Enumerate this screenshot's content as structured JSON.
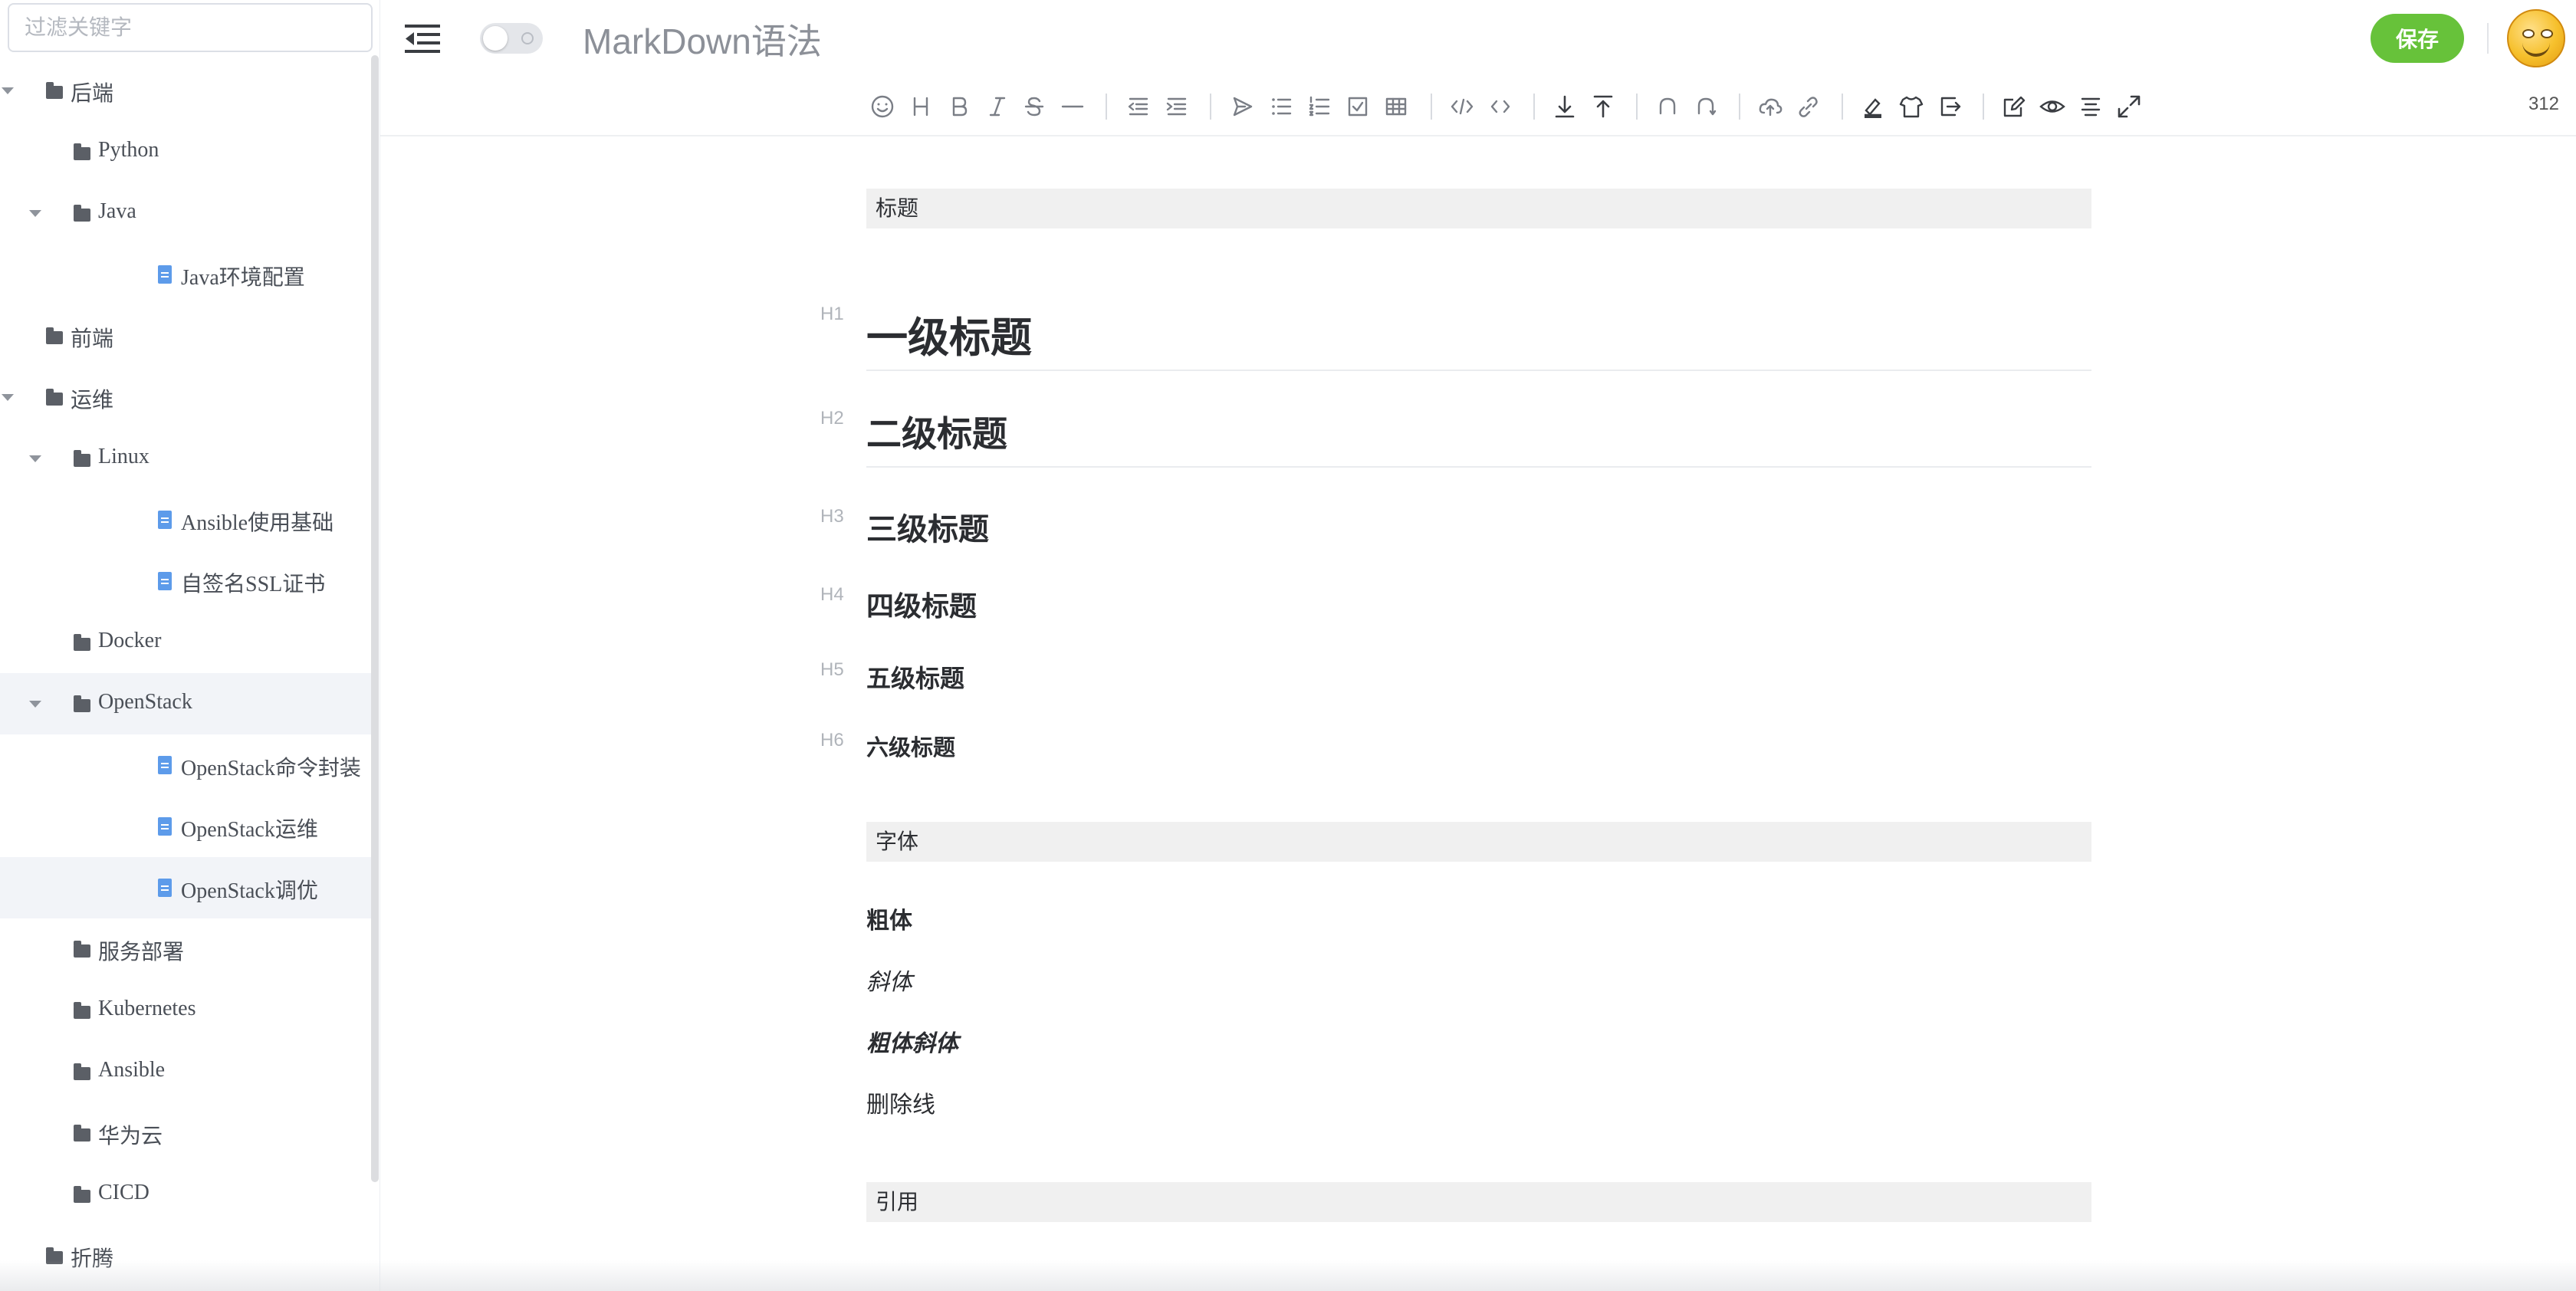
{
  "sidebar": {
    "filter_placeholder": "过滤关键字",
    "tree": [
      {
        "label": "后端",
        "type": "folder",
        "level": 0,
        "expanded": true
      },
      {
        "label": "Python",
        "type": "folder",
        "level": 1,
        "expanded": false
      },
      {
        "label": "Java",
        "type": "folder",
        "level": 1,
        "expanded": true
      },
      {
        "label": "Java环境配置",
        "type": "file",
        "level": 2
      },
      {
        "label": "前端",
        "type": "folder",
        "level": 0,
        "expanded": false
      },
      {
        "label": "运维",
        "type": "folder",
        "level": 0,
        "expanded": true
      },
      {
        "label": "Linux",
        "type": "folder",
        "level": 1,
        "expanded": true
      },
      {
        "label": "Ansible使用基础",
        "type": "file",
        "level": 2
      },
      {
        "label": "自签名SSL证书",
        "type": "file",
        "level": 2
      },
      {
        "label": "Docker",
        "type": "folder",
        "level": 1,
        "expanded": false
      },
      {
        "label": "OpenStack",
        "type": "folder",
        "level": 1,
        "expanded": true,
        "highlighted": true
      },
      {
        "label": "OpenStack命令封装",
        "type": "file",
        "level": 2
      },
      {
        "label": "OpenStack运维",
        "type": "file",
        "level": 2
      },
      {
        "label": "OpenStack调优",
        "type": "file",
        "level": 2,
        "selected": true
      },
      {
        "label": "服务部署",
        "type": "folder",
        "level": 1,
        "expanded": false
      },
      {
        "label": "Kubernetes",
        "type": "folder",
        "level": 1,
        "expanded": false
      },
      {
        "label": "Ansible",
        "type": "folder",
        "level": 1,
        "expanded": false
      },
      {
        "label": "华为云",
        "type": "folder",
        "level": 1,
        "expanded": false
      },
      {
        "label": "CICD",
        "type": "folder",
        "level": 1,
        "expanded": false
      },
      {
        "label": "折腾",
        "type": "folder",
        "level": 0,
        "expanded": false
      }
    ]
  },
  "header": {
    "menu_icon": "menu-fold-icon",
    "theme_toggle": "off",
    "title": "MarkDown语法",
    "save_label": "保存",
    "avatar": "smiley-avatar"
  },
  "toolbar": {
    "word_count": "312",
    "buttons": [
      "emoji",
      "heading",
      "bold",
      "italic",
      "strike",
      "hr",
      "outdent",
      "indent",
      "quote",
      "ul",
      "ol",
      "check",
      "table",
      "code-block",
      "inline-code",
      "insert-after",
      "insert-before",
      "undo",
      "redo",
      "upload",
      "link",
      "record",
      "theme",
      "export",
      "edit-mode",
      "preview",
      "outline",
      "fullscreen"
    ]
  },
  "content": {
    "section_title": "标题",
    "h_markers": [
      "H1",
      "H2",
      "H3",
      "H4",
      "H5",
      "H6"
    ],
    "h1": "一级标题",
    "h2": "二级标题",
    "h3": "三级标题",
    "h4": "四级标题",
    "h5": "五级标题",
    "h6": "六级标题",
    "font_section": "字体",
    "bold": "粗体",
    "italic": "斜体",
    "bold_italic": "粗体斜体",
    "strike": "删除线",
    "quote_section": "引用"
  },
  "colors": {
    "accent": "#67c23a",
    "file_icon": "#5d9bea",
    "highlight_row": "#f2f4f8"
  }
}
